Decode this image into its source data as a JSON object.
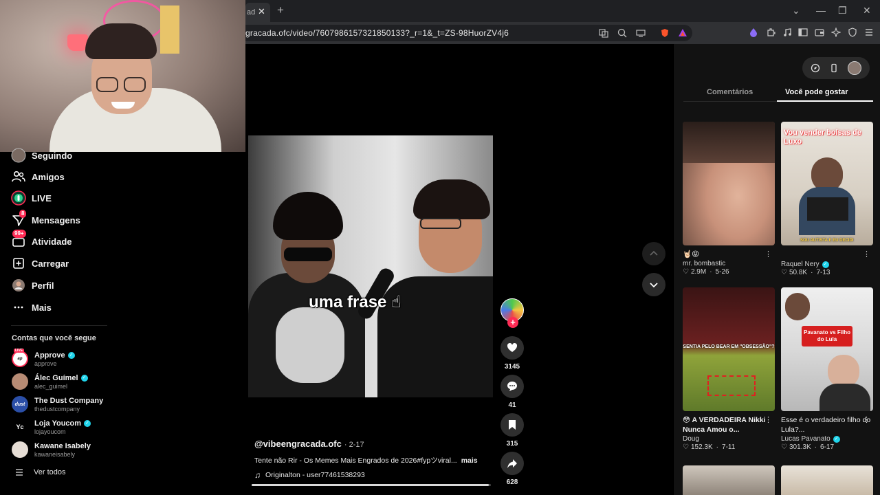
{
  "browser": {
    "tab_title": "ad",
    "url": "gracada.ofc/video/7607986157321850133?_r=1&_t=ZS-98HuorZV4j6",
    "colors": {
      "accent": "#fe2c55",
      "verified": "#20d5ec"
    }
  },
  "sidebar": {
    "items": [
      {
        "label": "Seguindo",
        "icon": "following-avatar-icon"
      },
      {
        "label": "Amigos",
        "icon": "friends-icon"
      },
      {
        "label": "LIVE",
        "icon": "live-icon"
      },
      {
        "label": "Mensagens",
        "icon": "messages-icon",
        "badge": "8"
      },
      {
        "label": "Atividade",
        "icon": "activity-icon",
        "badge": "99+"
      },
      {
        "label": "Carregar",
        "icon": "upload-icon"
      },
      {
        "label": "Perfil",
        "icon": "profile-avatar-icon"
      },
      {
        "label": "Mais",
        "icon": "more-icon"
      }
    ],
    "following_title": "Contas que você segue",
    "following": [
      {
        "name": "Approve",
        "handle": "approve",
        "verified": true,
        "live": true
      },
      {
        "name": "Álec Guímel",
        "handle": "alec_guimel",
        "verified": true
      },
      {
        "name": "The Dust Company",
        "handle": "thedustcompany",
        "verified": false
      },
      {
        "name": "Loja Youcom",
        "handle": "lojayoucom",
        "verified": true
      },
      {
        "name": "Kawane Isabely",
        "handle": "kawaneisabely",
        "verified": false
      }
    ],
    "live_tag": "LIVE",
    "see_all": "Ver todos"
  },
  "video": {
    "caption": "uma frase ☝",
    "author": "@vibeengracada.ofc",
    "date": "· 2-17",
    "description": "Tente não Rir - Os Memes Mais Engrados de 2026#fypツviral...",
    "more": "mais",
    "music": "Originalton - user77461538293",
    "progress": 0.99,
    "likes": "3145",
    "comments": "41",
    "saves": "315",
    "shares": "628"
  },
  "right_panel": {
    "tabs": [
      {
        "label": "Comentários",
        "active": false
      },
      {
        "label": "Você pode gostar",
        "active": true
      }
    ],
    "cards": [
      {
        "title": "🤘🏻😝",
        "author": "mr. bombastic",
        "verified": false,
        "likes": "2.9M",
        "date": "5-26",
        "thumb_text": ""
      },
      {
        "title": "",
        "author": "Raquel Nery",
        "verified": true,
        "likes": "50.8K",
        "date": "7-13",
        "thumb_text": "Vou vender bolsas de Luxo",
        "thumb_sub": "SOU AUTISTA E EU DECIDI"
      },
      {
        "title": "😳 A VERDADEIRA Nikki Nunca Amou o...",
        "author": "Doug",
        "verified": false,
        "likes": "152.3K",
        "date": "7-11",
        "thumb_text": "SENTIA PELO BEAR EM \"OBSESSÃO\"?"
      },
      {
        "title": "Esse é o verdadeiro filho do Lula?...",
        "author": "Lucas Pavanato",
        "verified": true,
        "likes": "301.3K",
        "date": "6-17",
        "thumb_text": "Pavanato vs Filho do Lula"
      }
    ]
  }
}
